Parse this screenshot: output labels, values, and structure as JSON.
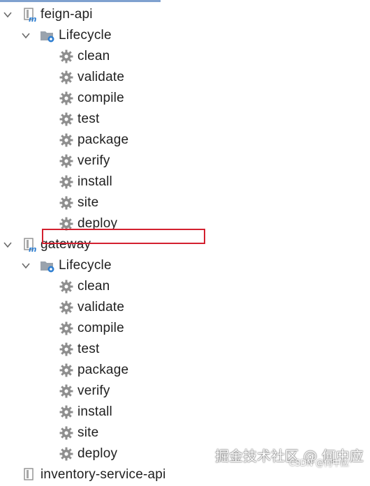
{
  "modules": [
    {
      "name": "feign-api",
      "lifecycle_label": "Lifecycle",
      "goals": [
        "clean",
        "validate",
        "compile",
        "test",
        "package",
        "verify",
        "install",
        "site",
        "deploy"
      ]
    },
    {
      "name": "gateway",
      "lifecycle_label": "Lifecycle",
      "goals": [
        "clean",
        "validate",
        "compile",
        "test",
        "package",
        "verify",
        "install",
        "site",
        "deploy"
      ]
    }
  ],
  "partial_next_module": "inventory-service-api",
  "watermark": {
    "line1": "掘金技术社区 @ 何中应",
    "line2": "CSDN @何中应"
  },
  "colors": {
    "highlight_border": "#d3202f",
    "gear": "#8e8e8e",
    "folder": "#9aa3ad",
    "maven_blue": "#2f7fd1"
  }
}
